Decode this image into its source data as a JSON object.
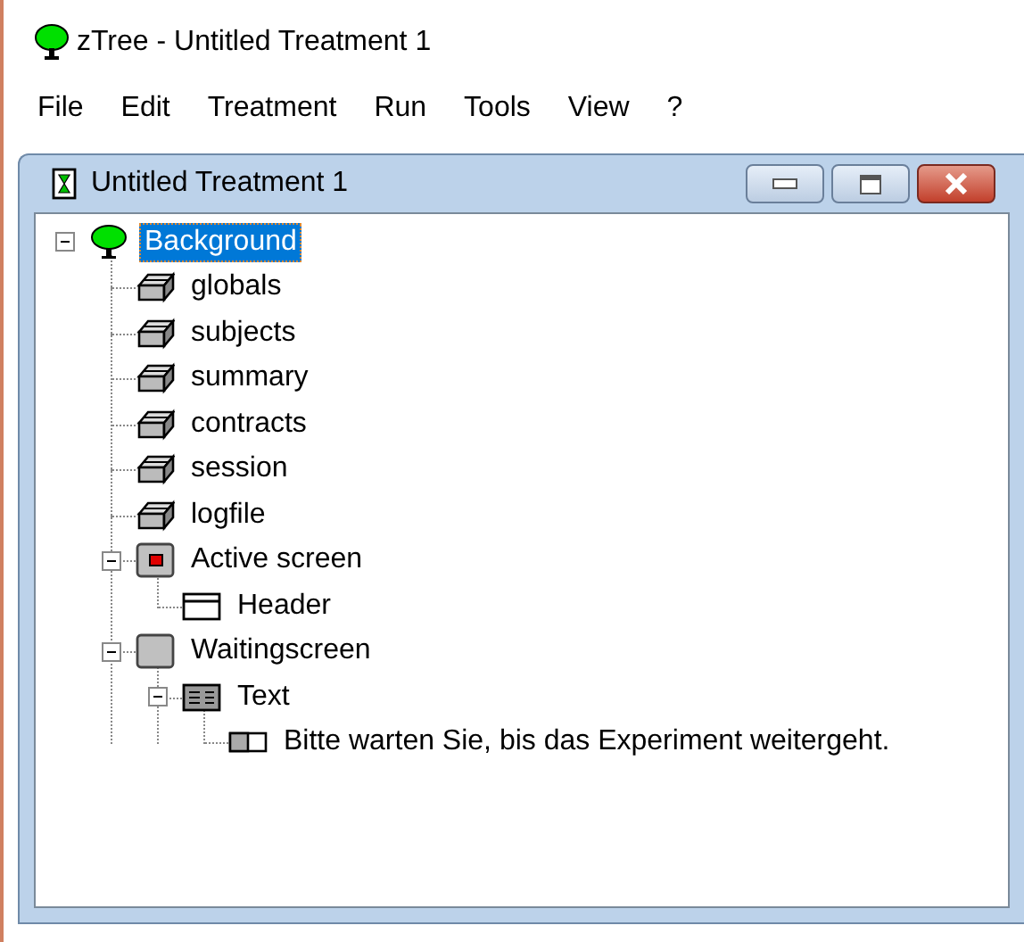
{
  "window": {
    "title": "zTree - Untitled Treatment 1"
  },
  "menu": [
    "File",
    "Edit",
    "Treatment",
    "Run",
    "Tools",
    "View",
    "?"
  ],
  "document": {
    "title": "Untitled Treatment 1",
    "tree": [
      {
        "label": "Background",
        "kind": "background",
        "expanded": true,
        "selected": true,
        "children": [
          {
            "label": "globals",
            "kind": "table",
            "selected": false
          },
          {
            "label": "subjects",
            "kind": "table",
            "selected": false
          },
          {
            "label": "summary",
            "kind": "table",
            "selected": false
          },
          {
            "label": "contracts",
            "kind": "table",
            "selected": false
          },
          {
            "label": "session",
            "kind": "table",
            "selected": false
          },
          {
            "label": "logfile",
            "kind": "table",
            "selected": false
          },
          {
            "label": "Active screen",
            "kind": "active-screen",
            "expanded": true,
            "selected": false,
            "children": [
              {
                "label": "Header",
                "kind": "header",
                "selected": false
              }
            ]
          },
          {
            "label": "Waitingscreen",
            "kind": "screen",
            "expanded": true,
            "selected": false,
            "children": [
              {
                "label": "Text",
                "kind": "text-box",
                "expanded": true,
                "selected": false,
                "children": [
                  {
                    "label": "Bitte warten Sie, bis das Experiment weitergeht.",
                    "kind": "item",
                    "selected": false
                  }
                ]
              }
            ]
          }
        ]
      }
    ]
  }
}
